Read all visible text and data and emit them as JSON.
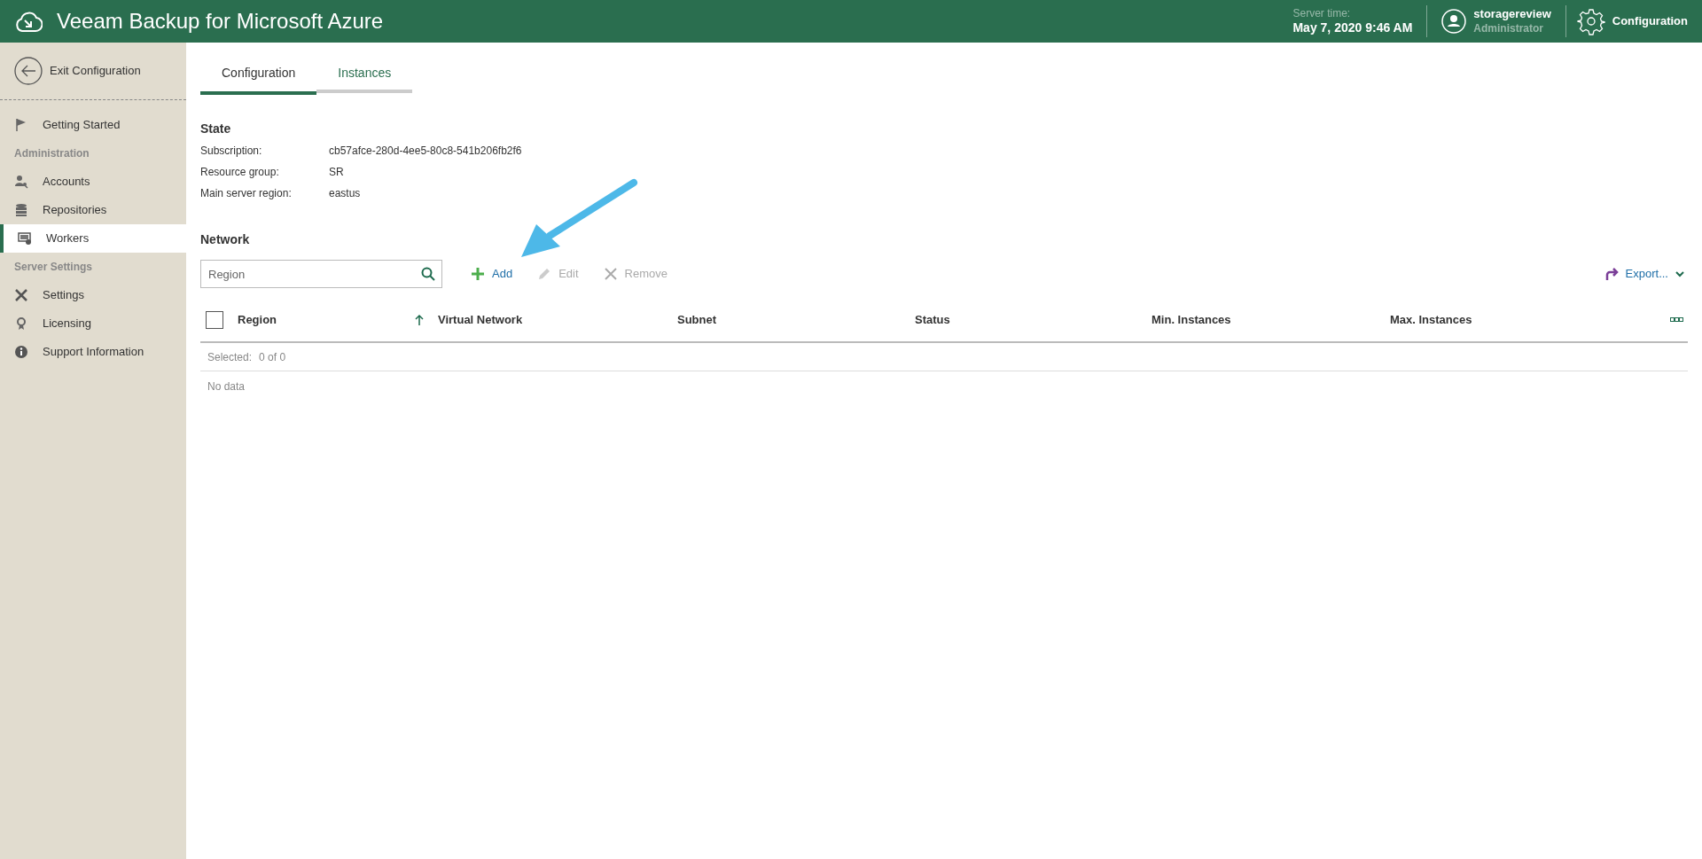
{
  "header": {
    "title": "Veeam Backup for Microsoft Azure",
    "server_time_label": "Server time:",
    "server_time": "May 7, 2020 9:46 AM",
    "user_name": "storagereview",
    "user_role": "Administrator",
    "config_label": "Configuration"
  },
  "sidebar": {
    "exit_label": "Exit Configuration",
    "items": [
      {
        "kind": "item",
        "label": "Getting Started",
        "selected": false
      },
      {
        "kind": "section",
        "label": "Administration"
      },
      {
        "kind": "item",
        "label": "Accounts",
        "selected": false
      },
      {
        "kind": "item",
        "label": "Repositories",
        "selected": false
      },
      {
        "kind": "item",
        "label": "Workers",
        "selected": true
      },
      {
        "kind": "section",
        "label": "Server Settings"
      },
      {
        "kind": "item",
        "label": "Settings",
        "selected": false
      },
      {
        "kind": "item",
        "label": "Licensing",
        "selected": false
      },
      {
        "kind": "item",
        "label": "Support Information",
        "selected": false
      }
    ]
  },
  "tabs": [
    {
      "label": "Configuration",
      "selected": true
    },
    {
      "label": "Instances",
      "selected": false
    }
  ],
  "state": {
    "title": "State",
    "fields": [
      {
        "label": "Subscription:",
        "value": "cb57afce-280d-4ee5-80c8-541b206fb2f6"
      },
      {
        "label": "Resource group:",
        "value": "SR"
      },
      {
        "label": "Main server region:",
        "value": "eastus"
      }
    ]
  },
  "network": {
    "title": "Network",
    "search": {
      "placeholder": "Region"
    },
    "actions": [
      {
        "kind": "add",
        "label": "Add",
        "disabled": false
      },
      {
        "kind": "edit",
        "label": "Edit",
        "disabled": true
      },
      {
        "kind": "remove",
        "label": "Remove",
        "disabled": true
      }
    ],
    "export_label": "Export...",
    "table": {
      "select_all_checked": false,
      "columns": [
        {
          "label": "Region",
          "sorted": true
        },
        {
          "label": "Virtual Network",
          "sorted": false
        },
        {
          "label": "Subnet",
          "sorted": false
        },
        {
          "label": "Status",
          "sorted": false
        },
        {
          "label": "Min. Instances",
          "sorted": false
        },
        {
          "label": "Max. Instances",
          "sorted": false
        }
      ],
      "selected_label": "Selected:",
      "selected_count": "0 of 0",
      "empty_text": "No data"
    }
  }
}
